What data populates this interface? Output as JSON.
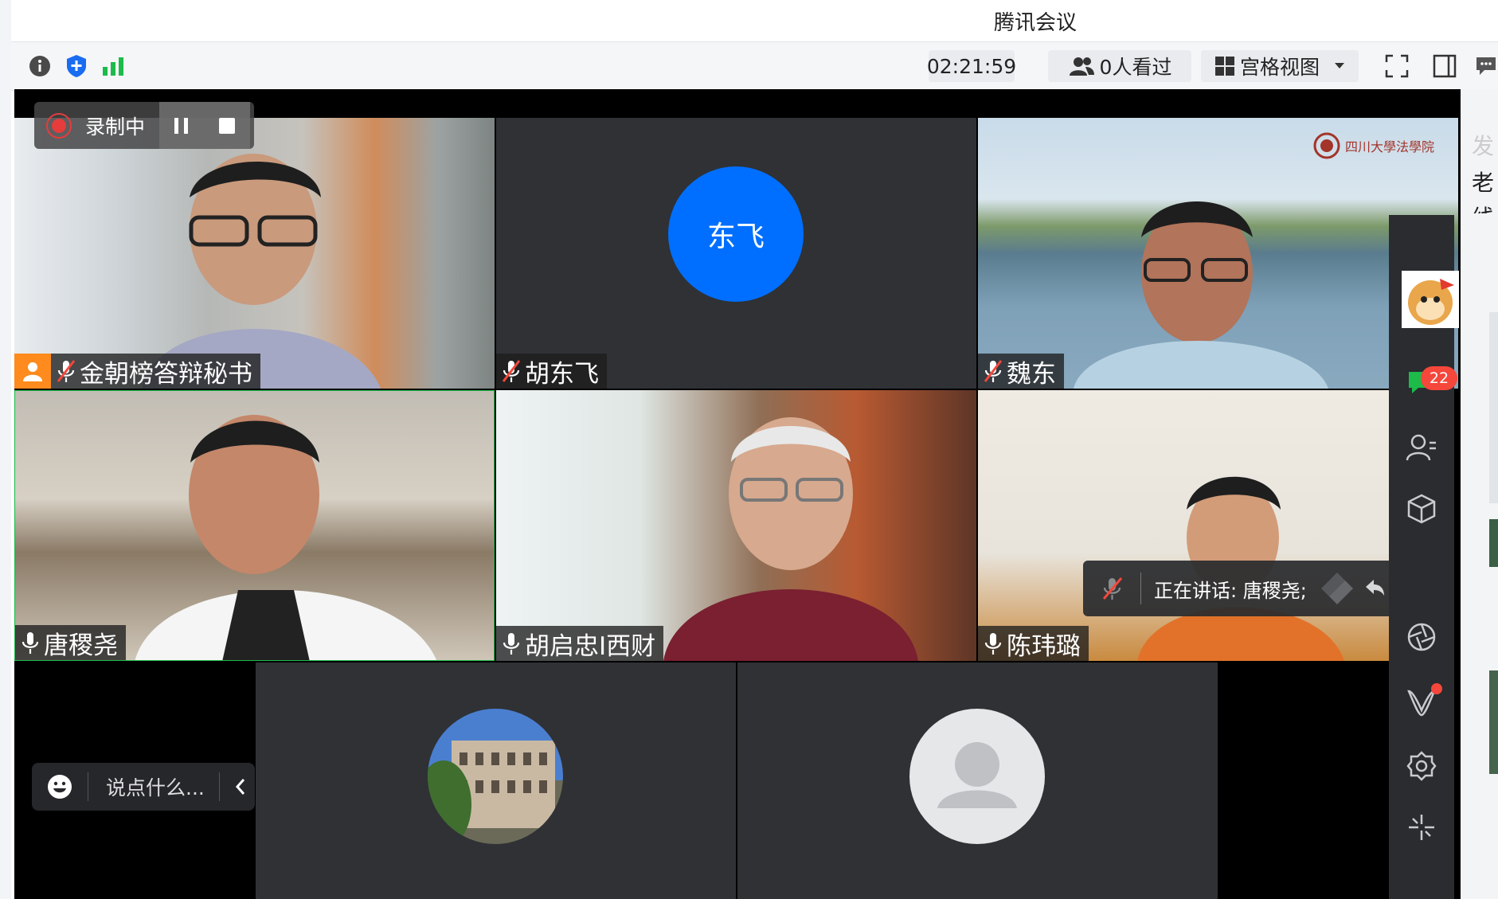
{
  "window": {
    "title": "腾讯会议"
  },
  "toolbar": {
    "timer": "02:21:59",
    "viewers_label": "0人看过",
    "view_mode_label": "宫格视图"
  },
  "recording": {
    "label": "录制中"
  },
  "participants": [
    {
      "name": "金朝榜答辩秘书",
      "muted": true,
      "host": true
    },
    {
      "name": "胡东飞",
      "muted": true,
      "avatar_text": "东飞"
    },
    {
      "name": "魏东",
      "muted": true
    },
    {
      "name": "唐稷尧",
      "muted": false
    },
    {
      "name": "胡启忠I西财",
      "muted": false
    },
    {
      "name": "陈玮璐",
      "muted": false
    }
  ],
  "speaking": {
    "label": "正在讲话: 唐稷尧;"
  },
  "chat": {
    "placeholder": "说点什么..."
  },
  "sidebar": {
    "chat_badge": "22"
  },
  "watermark": {
    "text": "四川大學法學院"
  },
  "right_panel": {
    "chars": [
      "发",
      "老",
      "线"
    ]
  },
  "colors": {
    "accent_blue": "#006fff",
    "host_orange": "#ff8a1d",
    "badge_red": "#f5473b",
    "chat_green": "#1cbb4a"
  }
}
